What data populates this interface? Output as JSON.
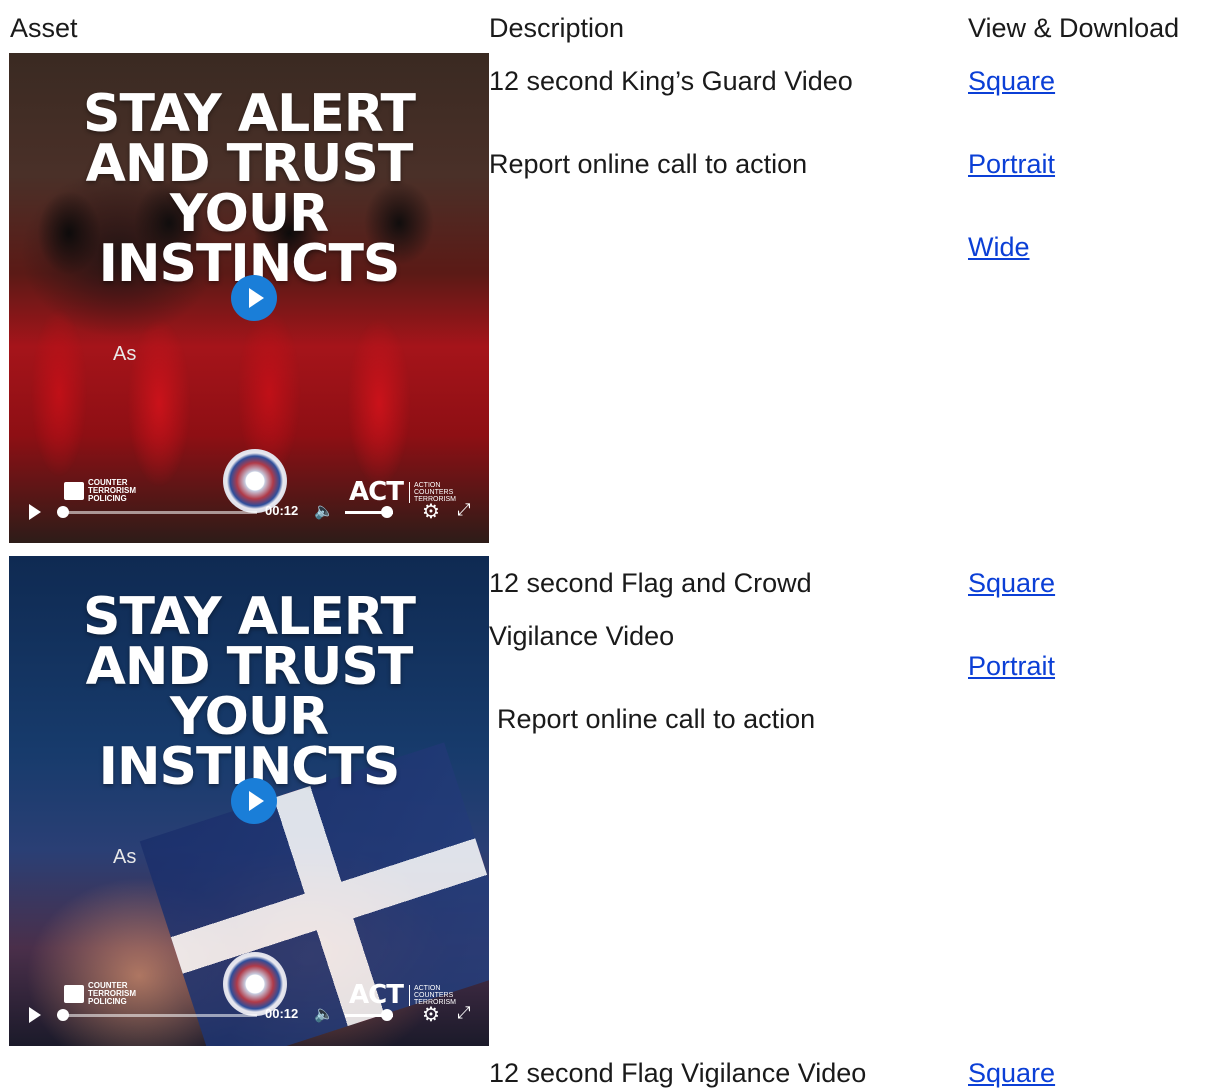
{
  "headers": {
    "asset": "Asset",
    "description": "Description",
    "view_download": "View & Download"
  },
  "rows": [
    {
      "description_line1": "12 second King’s Guard Video",
      "description_cta": "Report online call to action",
      "links": [
        "Square",
        "Portrait",
        "Wide"
      ],
      "video": {
        "headline": [
          "STAY ALERT",
          "AND TRUST",
          "YOUR",
          "INSTINCTS"
        ],
        "overlay_text": "As",
        "time": "00:12",
        "ctp_logo": [
          "COUNTER",
          "TERRORISM",
          "POLICING"
        ],
        "act_logo": "ACT",
        "act_tagline": [
          "ACTION",
          "COUNTERS",
          "TERRORISM"
        ]
      }
    },
    {
      "description_line1": "12 second Flag and Crowd",
      "description_line2": "Vigilance Video",
      "description_cta": "Report online call to action",
      "links": [
        "Square",
        "Portrait"
      ],
      "video": {
        "headline": [
          "STAY ALERT",
          "AND TRUST",
          "YOUR",
          "INSTINCTS"
        ],
        "overlay_text": "As",
        "time": "00:12",
        "ctp_logo": [
          "COUNTER",
          "TERRORISM",
          "POLICING"
        ],
        "act_logo": "ACT",
        "act_tagline": [
          "ACTION",
          "COUNTERS",
          "TERRORISM"
        ]
      }
    },
    {
      "description_line1": "12 second Flag Vigilance Video",
      "links": [
        "Square"
      ]
    }
  ],
  "colors": {
    "link": "#0b3fd6",
    "play_button": "#1a7ed8",
    "text": "#1a1a1a"
  }
}
